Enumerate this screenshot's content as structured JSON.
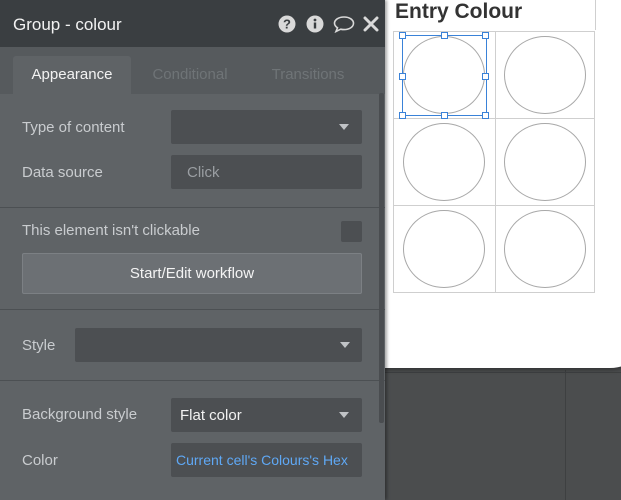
{
  "panel": {
    "title": "Group - colour",
    "header_icons": [
      "question-icon",
      "info-icon",
      "comment-icon",
      "close-icon"
    ],
    "tabs": [
      {
        "label": "Appearance",
        "active": true
      },
      {
        "label": "Conditional",
        "active": false
      },
      {
        "label": "Transitions",
        "active": false
      }
    ],
    "type_of_content": {
      "label": "Type of content",
      "value": ""
    },
    "data_source": {
      "label": "Data source",
      "placeholder": "Click"
    },
    "not_clickable": {
      "label": "This element isn't clickable",
      "checked": false
    },
    "workflow_button": "Start/Edit workflow",
    "style": {
      "label": "Style",
      "value": ""
    },
    "background_style": {
      "label": "Background style",
      "value": "Flat color"
    },
    "color": {
      "label": "Color",
      "value": "Current cell's Colours's Hex"
    }
  },
  "preview": {
    "heading": "Entry Colour",
    "repeating_group": {
      "columns": 2,
      "rows": 3,
      "selected_cell": 0
    }
  },
  "colors": {
    "panel_bg": "#5f6366",
    "header_bg": "#3a3e41",
    "dynamic_link": "#5fa8f5",
    "selection": "#3a82d8"
  }
}
